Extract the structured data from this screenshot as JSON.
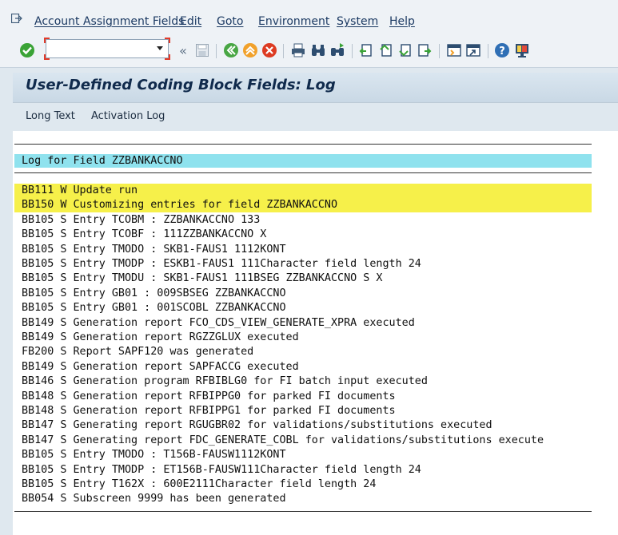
{
  "menubar": {
    "items": [
      "Account Assignment Fields",
      "Edit",
      "Goto",
      "Environment",
      "System",
      "Help"
    ]
  },
  "toolbar": {
    "command_value": "",
    "icons": [
      "check-icon",
      "back-icon",
      "save-icon",
      "green-back-icon",
      "exit-icon",
      "cancel-icon",
      "print-icon",
      "find-icon",
      "find-next-icon",
      "first-page-icon",
      "prev-page-icon",
      "next-page-icon",
      "last-page-icon",
      "new-session-icon",
      "shortcut-icon",
      "help-icon",
      "customize-layout-icon"
    ]
  },
  "title": "User-Defined Coding Block Fields: Log",
  "app_toolbar": {
    "long_text": "Long Text",
    "activation_log": "Activation Log"
  },
  "log": {
    "header": "Log for Field ZZBANKACCNO",
    "lines": [
      "BB111 W Update run",
      "BB150 W Customizing entries for field ZZBANKACCNO",
      "BB105 S Entry TCOBM : ZZBANKACCNO 133",
      "BB105 S Entry TCOBF : 111ZZBANKACCNO X",
      "BB105 S Entry TMODO : SKB1-FAUS1 1112KONT",
      "BB105 S Entry TMODP : ESKB1-FAUS1 111Character field length 24",
      "BB105 S Entry TMODU : SKB1-FAUS1 111BSEG ZZBANKACCNO S X",
      "BB105 S Entry GB01 : 009SBSEG ZZBANKACCNO",
      "BB105 S Entry GB01 : 001SCOBL ZZBANKACCNO",
      "BB149 S Generation report FCO_CDS_VIEW_GENERATE_XPRA executed",
      "BB149 S Generation report RGZZGLUX executed",
      "FB200 S Report SAPF120 was generated",
      "BB149 S Generation report SAPFACCG executed",
      "BB146 S Generation program RFBIBLG0 for FI batch input executed",
      "BB148 S Generation report RFBIPPG0 for parked FI documents",
      "BB148 S Generation report RFBIPPG1 for parked FI documents",
      "BB147 S Generating report RGUGBR02 for validations/substitutions executed",
      "BB147 S Generating report FDC_GENERATE_COBL for validations/substitutions execute",
      "BB105 S Entry TMODO : T156B-FAUSW1112KONT",
      "BB105 S Entry TMODP : ET156B-FAUSW111Character field length 24",
      "BB105 S Entry T162X : 600E2111Character field length 24",
      "BB054 S Subscreen 9999 has been generated"
    ]
  },
  "colors": {
    "header_bg": "#8fe2ee",
    "warning_bg": "#f6f04a",
    "title_text": "#102a4c"
  }
}
